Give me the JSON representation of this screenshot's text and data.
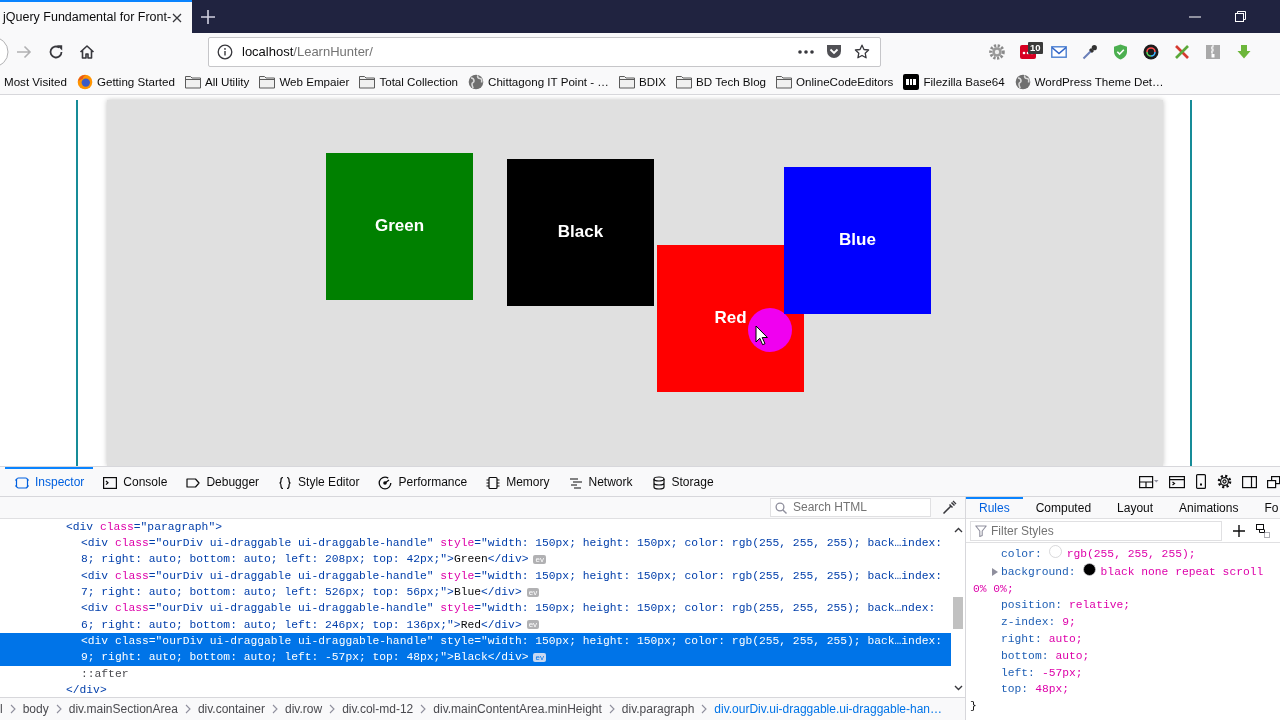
{
  "browser": {
    "tabs": [
      {
        "title": "jQuery Fundamental for Front-",
        "selected": true
      }
    ],
    "url": {
      "host": "localhost",
      "path": "/LearnHunter/"
    },
    "extension_badge": "10",
    "bookmarks": [
      {
        "label": "Most Visited",
        "kind": "plain"
      },
      {
        "label": "Getting Started",
        "kind": "browser"
      },
      {
        "label": "All Utility",
        "kind": "folder"
      },
      {
        "label": "Web Empaier",
        "kind": "folder"
      },
      {
        "label": "Total Collection",
        "kind": "folder"
      },
      {
        "label": "Chittagong IT Point - …",
        "kind": "globe"
      },
      {
        "label": "BDIX",
        "kind": "folder"
      },
      {
        "label": "BD Tech Blog",
        "kind": "folder"
      },
      {
        "label": "OnlineCodeEditors",
        "kind": "folder"
      },
      {
        "label": "Filezilla Base64",
        "kind": "tile"
      },
      {
        "label": "WordPress Theme Det…",
        "kind": "globe"
      }
    ]
  },
  "page": {
    "tiles": [
      {
        "label": "Green",
        "color": "#008000"
      },
      {
        "label": "Blue",
        "color": "#0000ff"
      },
      {
        "label": "Red",
        "color": "#ff0000"
      },
      {
        "label": "Black",
        "color": "#000000"
      }
    ]
  },
  "devtools": {
    "tools": [
      {
        "label": "Inspector",
        "selected": true
      },
      {
        "label": "Console",
        "selected": false
      },
      {
        "label": "Debugger",
        "selected": false
      },
      {
        "label": "Style Editor",
        "selected": false
      },
      {
        "label": "Performance",
        "selected": false
      },
      {
        "label": "Memory",
        "selected": false
      },
      {
        "label": "Network",
        "selected": false
      },
      {
        "label": "Storage",
        "selected": false
      }
    ],
    "markup": {
      "search": {
        "placeholder": "Search HTML"
      },
      "tree": [
        {
          "selected": false,
          "lines": [
            {
              "parts": [
                {
                  "kind": "tag",
                  "text": "<div"
                },
                {
                  "kind": "attr",
                  "text": " class"
                },
                {
                  "kind": "tag",
                  "text": "="
                },
                {
                  "kind": "val",
                  "text": "\"paragraph\""
                },
                {
                  "kind": "tag",
                  "text": ">"
                }
              ]
            }
          ],
          "children": [
            {
              "selected": false,
              "badge": "ev",
              "lines": [
                {
                  "parts": [
                    {
                      "kind": "tag",
                      "text": "<div"
                    },
                    {
                      "kind": "attr",
                      "text": " class"
                    },
                    {
                      "kind": "tag",
                      "text": "="
                    },
                    {
                      "kind": "val",
                      "text": "\"ourDiv ui-draggable ui-draggable-handle\""
                    },
                    {
                      "kind": "attr",
                      "text": " style"
                    },
                    {
                      "kind": "tag",
                      "text": "="
                    },
                    {
                      "kind": "val",
                      "text": "\"width: 150px; height: 150px; color: rgb(255, 255, 255); back…index:"
                    }
                  ]
                },
                {
                  "parts": [
                    {
                      "kind": "val",
                      "text": "8; right: auto; bottom: auto; left: 208px; top: 42px;\""
                    },
                    {
                      "kind": "tag",
                      "text": ">"
                    },
                    {
                      "kind": "text",
                      "text": "Green"
                    },
                    {
                      "kind": "tag",
                      "text": "</div>"
                    }
                  ]
                }
              ]
            },
            {
              "selected": false,
              "badge": "ev",
              "lines": [
                {
                  "parts": [
                    {
                      "kind": "tag",
                      "text": "<div"
                    },
                    {
                      "kind": "attr",
                      "text": " class"
                    },
                    {
                      "kind": "tag",
                      "text": "="
                    },
                    {
                      "kind": "val",
                      "text": "\"ourDiv ui-draggable ui-draggable-handle\""
                    },
                    {
                      "kind": "attr",
                      "text": " style"
                    },
                    {
                      "kind": "tag",
                      "text": "="
                    },
                    {
                      "kind": "val",
                      "text": "\"width: 150px; height: 150px; color: rgb(255, 255, 255); back…index:"
                    }
                  ]
                },
                {
                  "parts": [
                    {
                      "kind": "val",
                      "text": "7; right: auto; bottom: auto; left: 526px; top: 56px;\""
                    },
                    {
                      "kind": "tag",
                      "text": ">"
                    },
                    {
                      "kind": "text",
                      "text": "Blue"
                    },
                    {
                      "kind": "tag",
                      "text": "</div>"
                    }
                  ]
                }
              ]
            },
            {
              "selected": false,
              "badge": "ev",
              "lines": [
                {
                  "parts": [
                    {
                      "kind": "tag",
                      "text": "<div"
                    },
                    {
                      "kind": "attr",
                      "text": " class"
                    },
                    {
                      "kind": "tag",
                      "text": "="
                    },
                    {
                      "kind": "val",
                      "text": "\"ourDiv ui-draggable ui-draggable-handle\""
                    },
                    {
                      "kind": "attr",
                      "text": " style"
                    },
                    {
                      "kind": "tag",
                      "text": "="
                    },
                    {
                      "kind": "val",
                      "text": "\"width: 150px; height: 150px; color: rgb(255, 255, 255); back…ndex:"
                    }
                  ]
                },
                {
                  "parts": [
                    {
                      "kind": "val",
                      "text": "6; right: auto; bottom: auto; left: 246px; top: 136px;\""
                    },
                    {
                      "kind": "tag",
                      "text": ">"
                    },
                    {
                      "kind": "text",
                      "text": "Red"
                    },
                    {
                      "kind": "tag",
                      "text": "</div>"
                    }
                  ]
                }
              ]
            },
            {
              "selected": true,
              "badge": "ev",
              "lines": [
                {
                  "parts": [
                    {
                      "kind": "tag",
                      "text": "<div"
                    },
                    {
                      "kind": "attr",
                      "text": " class"
                    },
                    {
                      "kind": "tag",
                      "text": "="
                    },
                    {
                      "kind": "val",
                      "text": "\"ourDiv ui-draggable ui-draggable-handle\""
                    },
                    {
                      "kind": "attr",
                      "text": " style"
                    },
                    {
                      "kind": "tag",
                      "text": "="
                    },
                    {
                      "kind": "val",
                      "text": "\"width: 150px; height: 150px; color: rgb(255, 255, 255); back…index:"
                    }
                  ]
                },
                {
                  "parts": [
                    {
                      "kind": "val",
                      "text": "9; right: auto; bottom: auto; left: -57px; top: 48px;\""
                    },
                    {
                      "kind": "tag",
                      "text": ">"
                    },
                    {
                      "kind": "text",
                      "text": "Black"
                    },
                    {
                      "kind": "tag",
                      "text": "</div>"
                    }
                  ]
                }
              ]
            },
            {
              "selected": false,
              "lines": [
                {
                  "parts": [
                    {
                      "kind": "pseudo",
                      "text": "::after"
                    }
                  ]
                }
              ]
            }
          ],
          "close": {
            "parts": [
              {
                "kind": "tag",
                "text": "</div>"
              }
            ]
          }
        }
      ]
    },
    "breadcrumbs": [
      {
        "label": "l",
        "selected": false
      },
      {
        "label": "body",
        "selected": false
      },
      {
        "label": "div.mainSectionArea",
        "selected": false
      },
      {
        "label": "div.container",
        "selected": false
      },
      {
        "label": "div.row",
        "selected": false
      },
      {
        "label": "div.col-md-12",
        "selected": false
      },
      {
        "label": "div.mainContentArea.minHeight",
        "selected": false
      },
      {
        "label": "div.paragraph",
        "selected": false
      },
      {
        "label": "div.ourDiv.ui-draggable.ui-draggable-han…",
        "selected": true
      }
    ],
    "sidebar": {
      "tabs": [
        {
          "label": "Rules",
          "selected": true
        },
        {
          "label": "Computed",
          "selected": false
        },
        {
          "label": "Layout",
          "selected": false
        },
        {
          "label": "Animations",
          "selected": false
        },
        {
          "label": "Fo",
          "selected": false
        }
      ],
      "filter": {
        "placeholder": "Filter Styles"
      },
      "declarations": [
        {
          "kind": "swatch",
          "name": "color:",
          "value": "rgb(255, 255, 255);",
          "color": "#ffffff"
        },
        {
          "kind": "shorthand",
          "name": "background:",
          "value": "black none repeat scroll 0% 0%;",
          "color": "#000000",
          "expanded": false
        },
        {
          "kind": "plain",
          "name": "position:",
          "value": "relative;"
        },
        {
          "kind": "plain",
          "name": "z-index:",
          "value": "9;"
        },
        {
          "kind": "plain",
          "name": "right:",
          "value": "auto;"
        },
        {
          "kind": "plain",
          "name": "bottom:",
          "value": "auto;"
        },
        {
          "kind": "plain",
          "name": "left:",
          "value": "-57px;"
        },
        {
          "kind": "plain",
          "name": "top:",
          "value": "48px;"
        }
      ],
      "closing": "}"
    }
  }
}
